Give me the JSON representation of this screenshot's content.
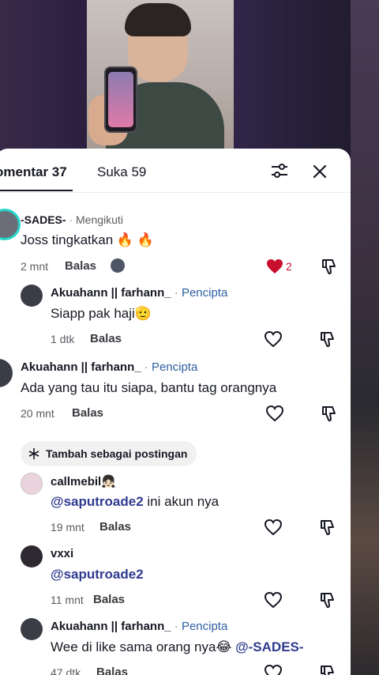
{
  "tabs": {
    "comments_label": "omentar 37",
    "likes_label": "Suka 59"
  },
  "icons": {
    "filter": "filter-icon",
    "close": "close-icon",
    "like": "heart-icon",
    "dislike": "thumbs-down-icon",
    "sparkle": "sparkle-icon"
  },
  "colors": {
    "accent_like": "#fe2c55",
    "creator_label": "#2d5fa0",
    "mention": "#2f3b8f"
  },
  "comments": [
    {
      "username": "-SADES-",
      "badge": "Mengikuti",
      "text": "Joss tingkatkan 🔥 🔥",
      "time": "2 mnt",
      "reply_label": "Balas",
      "likes": "2",
      "liked": true
    },
    {
      "username": "Akuahann || farhann_",
      "badge": "Pencipta",
      "text": "Siapp pak haji🫡",
      "time": "1 dtk",
      "reply_label": "Balas"
    },
    {
      "username": "Akuahann || farhann_",
      "badge": "Pencipta",
      "text": "Ada yang tau itu siapa, bantu tag orangnya",
      "time": "20 mnt",
      "reply_label": "Balas",
      "add_post_label": "Tambah sebagai postingan"
    },
    {
      "username": "callmebil👧🏻",
      "mention": "@saputroade2",
      "text": " ini akun nya",
      "time": "19 mnt",
      "reply_label": "Balas"
    },
    {
      "username": "vxxi",
      "mention": "@saputroade2",
      "time": "11 mnt",
      "reply_label": "Balas"
    },
    {
      "username": "Akuahann || farhann_",
      "badge": "Pencipta",
      "text": "Wee di like sama orang nya😂 ",
      "mention": "@-SADES-",
      "time": "47 dtk",
      "reply_label": "Balas"
    }
  ]
}
